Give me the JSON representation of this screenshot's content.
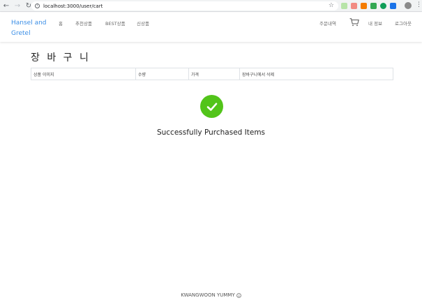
{
  "browser": {
    "url": "localhost:3000/user/cart",
    "back_icon": "arrow-left-icon",
    "forward_icon": "arrow-right-icon",
    "reload_icon": "reload-icon"
  },
  "header": {
    "brand": "Hansel and Gretel",
    "nav": {
      "home": "홈",
      "recommended": "추천상품",
      "best": "BEST상품",
      "new": "신상품"
    },
    "right": {
      "orders": "주문내역",
      "my_info": "내 정보",
      "logout": "로그아웃"
    },
    "brand_color": "#3a8ee6"
  },
  "main": {
    "title": "장 바 구 니",
    "table_headers": [
      "상품 이미지",
      "수량",
      "가격",
      "장바구니에서 삭제"
    ],
    "success_message": "Successfully Purchased Items",
    "success_color": "#52c41a"
  },
  "footer": {
    "text": "KWANGWOON YUMMY"
  }
}
